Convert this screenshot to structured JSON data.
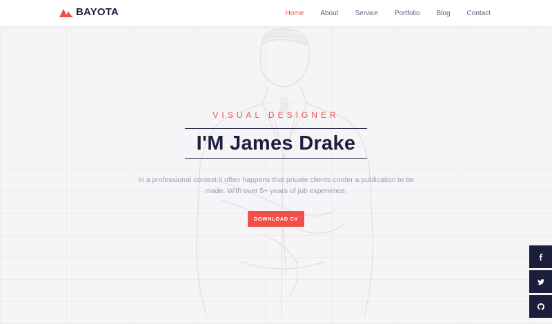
{
  "brand": {
    "name": "BAYOTA"
  },
  "nav": {
    "items": [
      {
        "label": "Home",
        "active": true
      },
      {
        "label": "About"
      },
      {
        "label": "Service"
      },
      {
        "label": "Portfolio"
      },
      {
        "label": "Blog"
      },
      {
        "label": "Contact"
      }
    ]
  },
  "hero": {
    "kicker": "VISUAL DESIGNER",
    "title": "I'M James Drake",
    "description": "In a professional context it often happens that private clients corder a publication to be made. With over 5+ years of job experience.",
    "cta_label": "DOWNLOAD CV"
  },
  "social": {
    "items": [
      {
        "icon": "facebook-icon"
      },
      {
        "icon": "twitter-icon"
      },
      {
        "icon": "github-icon"
      }
    ]
  },
  "colors": {
    "accent": "#f0504a",
    "dark": "#1b1f3b",
    "muted": "#9a9cab"
  }
}
